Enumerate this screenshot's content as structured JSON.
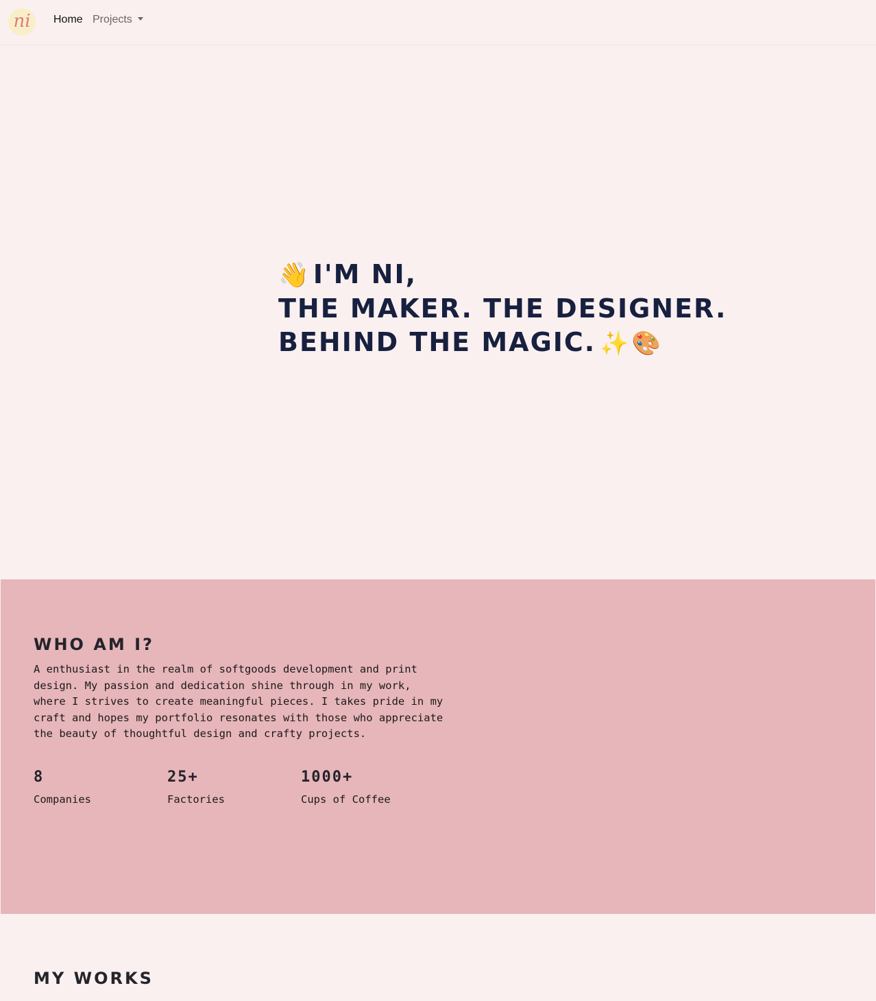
{
  "nav": {
    "logo_text": "ni",
    "home_label": "Home",
    "projects_label": "Projects"
  },
  "hero": {
    "wave_emoji": "👋",
    "line1": "I'M NI,",
    "line2": "THE MAKER. THE DESIGNER.",
    "line3": "BEHIND THE MAGIC.",
    "sparkle_emoji": "✨",
    "palette_emoji": "🎨"
  },
  "about": {
    "title": "WHO AM I?",
    "text": "A enthusiast in the realm of softgoods development and print design. My passion and dedication shine through in my work, where I strives to create meaningful pieces. I takes pride in my craft and hopes my portfolio resonates with those who appreciate the beauty of thoughtful design and crafty projects.",
    "stats": [
      {
        "value": "8",
        "label": "Companies"
      },
      {
        "value": "25+",
        "label": "Factories"
      },
      {
        "value": "1000+",
        "label": "Cups of Coffee"
      }
    ]
  },
  "works": {
    "title": "MY WORKS"
  },
  "colors": {
    "page_bg": "#faf0f0",
    "about_bg": "#e7b6ba",
    "hero_text": "#17203f",
    "logo_bg": "#f8efc9",
    "logo_text": "#de7b7b"
  }
}
